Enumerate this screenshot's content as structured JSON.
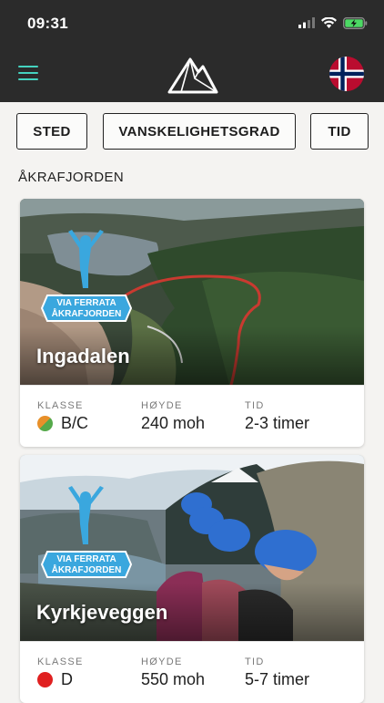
{
  "status": {
    "time": "09:31"
  },
  "filters": [
    {
      "label": "STED"
    },
    {
      "label": "VANSKELIGHETSGRAD"
    },
    {
      "label": "TID"
    }
  ],
  "section": {
    "title": "ÅKRAFJORDEN"
  },
  "badge": {
    "line1": "VIA FERRATA",
    "line2": "ÅKRAFJORDEN"
  },
  "labels": {
    "klasse": "KLASSE",
    "hoyde": "HØYDE",
    "tid": "TID"
  },
  "routes": [
    {
      "name": "Ingadalen",
      "klasse": "B/C",
      "hoyde": "240 moh",
      "tid": "2-3 timer",
      "difficulty_colors": [
        "#e8902a",
        "#55a94a"
      ]
    },
    {
      "name": "Kyrkjeveggen",
      "klasse": "D",
      "hoyde": "550 moh",
      "tid": "5-7 timer",
      "difficulty_colors": [
        "#e02020",
        "#e02020"
      ]
    }
  ],
  "colors": {
    "header": "#2b2b2b",
    "accent": "#45d3c0",
    "badge_blue": "#3aa7de"
  }
}
